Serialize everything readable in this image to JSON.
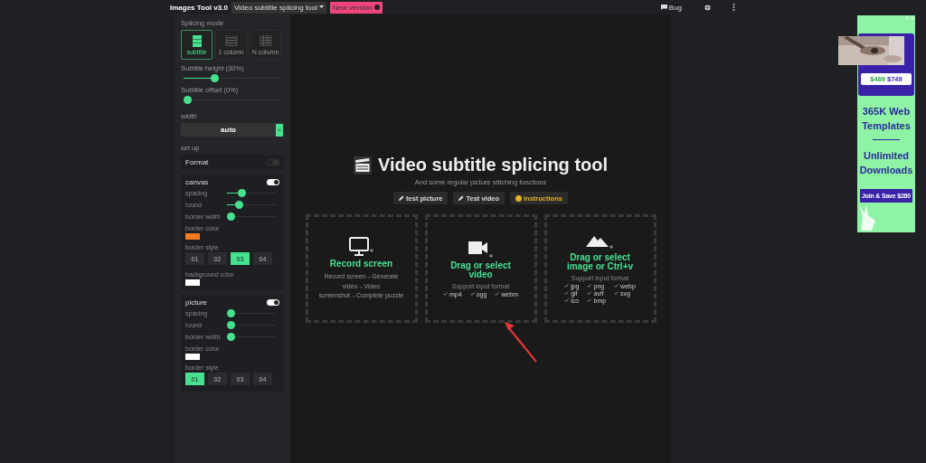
{
  "header": {
    "title": "Images Tool v3.0",
    "tool_select": "Video subtitle splicing tool",
    "new_version": "New version",
    "bug": "Bug"
  },
  "sidebar": {
    "mode_label": "Splicing mode",
    "modes": [
      {
        "label": "subtitle",
        "kind": "rows",
        "selected": true
      },
      {
        "label": "1 column",
        "kind": "column",
        "selected": false
      },
      {
        "label": "N column",
        "kind": "grid",
        "selected": false
      }
    ],
    "sliders": [
      {
        "label": "Subtitle height (30%)",
        "level": 0.3
      },
      {
        "label": "Subtitle offset (0%)",
        "level": 0
      }
    ],
    "width": {
      "label": "width",
      "value": "auto"
    },
    "setup_label": "set up",
    "panels": [
      {
        "title": "Format",
        "on": false
      },
      {
        "title": "canvas",
        "on": true,
        "items": [
          {
            "kind": "slider",
            "label": "spacing",
            "level": 0.26
          },
          {
            "kind": "slider",
            "label": "round",
            "level": 0.2
          },
          {
            "kind": "slider",
            "label": "border width",
            "level": 0
          },
          {
            "kind": "color",
            "label": "border color",
            "color": "#f47a1f"
          },
          {
            "kind": "styles",
            "label": "border style",
            "options": [
              {
                "label": "01",
                "selected": false
              },
              {
                "label": "02",
                "selected": false
              },
              {
                "label": "03",
                "selected": true
              },
              {
                "label": "04",
                "selected": false
              }
            ]
          },
          {
            "kind": "color",
            "label": "background color",
            "color": "#ffffff"
          }
        ]
      },
      {
        "title": "picture",
        "on": true,
        "items": [
          {
            "kind": "slider",
            "label": "spacing",
            "level": 0
          },
          {
            "kind": "slider",
            "label": "round",
            "level": 0
          },
          {
            "kind": "slider",
            "label": "border width",
            "level": 0
          },
          {
            "kind": "color",
            "label": "border color",
            "color": "#ffffff"
          },
          {
            "kind": "styles",
            "label": "border style",
            "options": [
              {
                "label": "01",
                "selected": true
              },
              {
                "label": "02",
                "selected": false
              },
              {
                "label": "03",
                "selected": false
              },
              {
                "label": "04",
                "selected": false
              }
            ]
          }
        ]
      }
    ]
  },
  "main": {
    "title": "Video subtitle splicing tool",
    "subtitle": "And some regular picture stitching functions",
    "buttons": [
      {
        "label": "test picture",
        "kind": "pencil"
      },
      {
        "label": "Test video",
        "kind": "pencil"
      },
      {
        "label": "Instructions",
        "kind": "help"
      }
    ],
    "drops": [
      {
        "kind": "monitor",
        "title": "Record screen",
        "desc": "Record screen→Generate video→Video screenshot→Complete puzzle"
      },
      {
        "kind": "video",
        "title": "Drag or select video",
        "note": "Support input format",
        "formats": [
          "mp4",
          "ogg",
          "webm"
        ]
      },
      {
        "title": "Drag or select image or Ctrl+v",
        "note": "Support input format",
        "formats": [
          "jpg",
          "png",
          "webp",
          "gif",
          "avif",
          "svg",
          "ico",
          "bmp"
        ]
      }
    ]
  },
  "ad": {
    "price_new": "$469",
    "price_old": "$749",
    "headline": "365K Web Templates",
    "subline": "Unlimited Downloads",
    "cta": "Join & Save $280"
  }
}
